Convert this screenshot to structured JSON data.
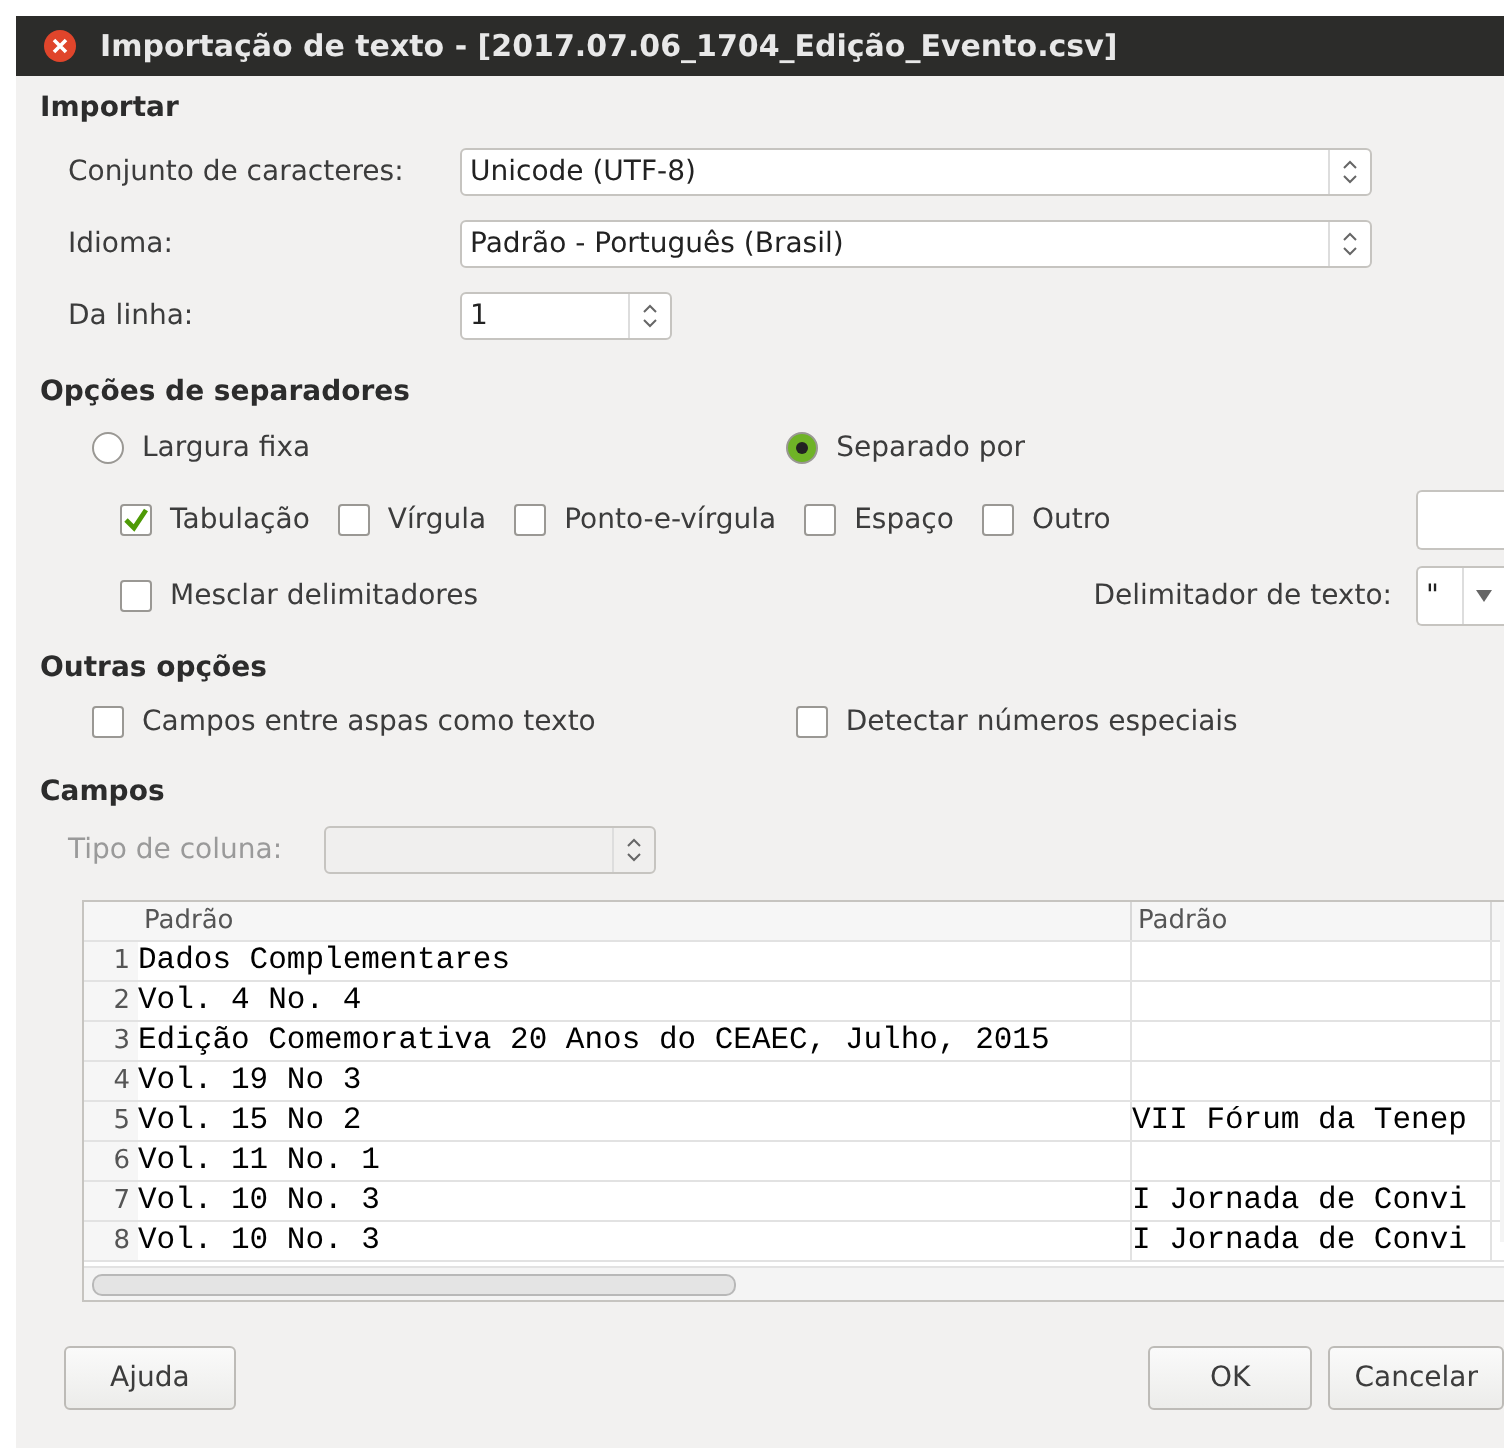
{
  "window": {
    "title": "Importação de texto - [2017.07.06_1704_Edição_Evento.csv]"
  },
  "import": {
    "heading": "Importar",
    "fields": [
      {
        "label": "Conjunto de caracteres:",
        "value": "Unicode (UTF-8)",
        "kind": "combo"
      },
      {
        "label": "Idioma:",
        "value": "Padrão - Português (Brasil)",
        "kind": "combo"
      },
      {
        "label": "Da linha:",
        "value": "1",
        "kind": "spin"
      }
    ]
  },
  "separator_options": {
    "heading": "Opções de separadores",
    "modes": [
      {
        "label": "Largura fixa",
        "selected": false
      },
      {
        "label": "Separado por",
        "selected": true
      }
    ],
    "separators": [
      {
        "label": "Tabulação",
        "checked": true
      },
      {
        "label": "Vírgula",
        "checked": false
      },
      {
        "label": "Ponto-e-vírgula",
        "checked": false
      },
      {
        "label": "Espaço",
        "checked": false
      },
      {
        "label": "Outro",
        "checked": false
      }
    ],
    "merge": {
      "label": "Mesclar delimitadores",
      "checked": false
    },
    "text_delimiter": {
      "label": "Delimitador de texto:",
      "value": "\""
    }
  },
  "other_options": {
    "heading": "Outras opções",
    "options": [
      {
        "label": "Campos entre aspas como texto",
        "checked": false
      },
      {
        "label": "Detectar números especiais",
        "checked": false
      }
    ]
  },
  "fields": {
    "heading": "Campos",
    "column_type": {
      "label": "Tipo de coluna:",
      "disabled": true
    },
    "table": {
      "columns": [
        "Padrão",
        "Padrão"
      ],
      "rows": [
        {
          "num": "1",
          "cells": [
            "Dados Complementares",
            ""
          ]
        },
        {
          "num": "2",
          "cells": [
            "Vol. 4 No. 4",
            ""
          ]
        },
        {
          "num": "3",
          "cells": [
            "Edição Comemorativa 20 Anos do CEAEC, Julho, 2015",
            ""
          ]
        },
        {
          "num": "4",
          "cells": [
            "Vol. 19 No 3",
            ""
          ]
        },
        {
          "num": "5",
          "cells": [
            "Vol. 15 No 2",
            "VII Fórum da Tenep"
          ]
        },
        {
          "num": "6",
          "cells": [
            "Vol. 11 No. 1",
            ""
          ]
        },
        {
          "num": "7",
          "cells": [
            "Vol. 10 No. 3",
            "I Jornada de Convi"
          ]
        },
        {
          "num": "8",
          "cells": [
            "Vol. 10 No. 3",
            "I Jornada de Convi"
          ]
        }
      ]
    }
  },
  "buttons": {
    "help": "Ajuda",
    "ok": "OK",
    "cancel": "Cancelar"
  }
}
